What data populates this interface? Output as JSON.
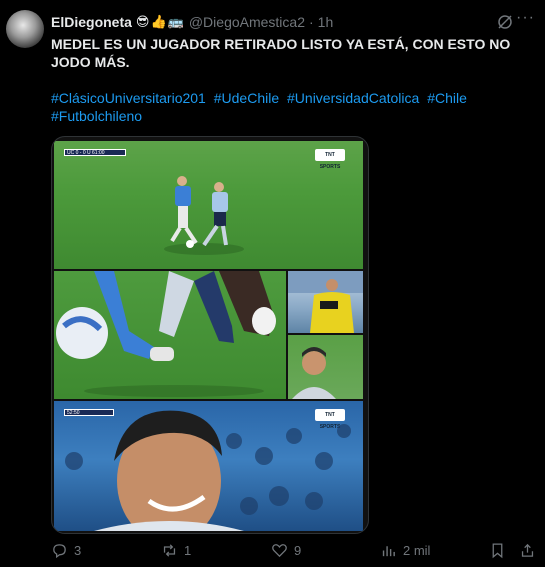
{
  "author": {
    "name": "ElDiegoneta",
    "emojis": "😎👍🚌",
    "handle": "@DiegoAmestica2",
    "time": "1h"
  },
  "tweet": {
    "text": "MEDEL ES UN JUGADOR RETIRADO LISTO YA ESTÁ, CON ESTO NO JODO MÁS.",
    "hashtags": [
      "#ClásicoUniversitario201",
      "#UdeChile",
      "#UniversidadCatolica",
      "#Chile",
      "#Futbolchileno"
    ]
  },
  "media": {
    "score_top": "UC 0 - 0 U",
    "clock_top": "61:00",
    "clock_bottom": "52:50",
    "broadcaster": "TNT SPORTS"
  },
  "actions": {
    "replies": "3",
    "reposts": "1",
    "likes": "9",
    "views": "2 mil"
  },
  "colors": {
    "accent": "#1d9bf0",
    "muted": "#71767b",
    "background": "#000000"
  }
}
